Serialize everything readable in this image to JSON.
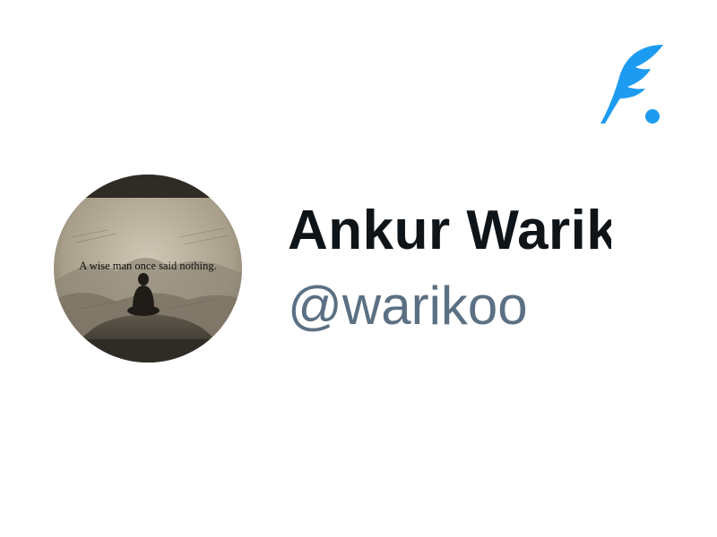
{
  "logo": {
    "icon": "feather-quill-icon",
    "color": "#1d9bf0"
  },
  "profile": {
    "display_name": "Ankur Warikoo",
    "handle": "@warikoo",
    "avatar": {
      "caption": "A wise man once said nothing."
    }
  },
  "colors": {
    "name": "#0f1419",
    "handle": "#5b7083",
    "accent": "#1d9bf0"
  }
}
